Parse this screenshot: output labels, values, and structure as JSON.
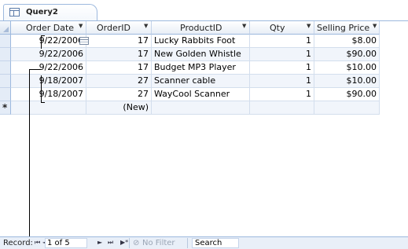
{
  "tab": {
    "label": "Query2",
    "icon": "query-table-icon"
  },
  "columns": [
    {
      "label": "Order Date",
      "has_arrow": true
    },
    {
      "label": "OrderID",
      "has_arrow": true
    },
    {
      "label": "ProductID",
      "has_arrow": true
    },
    {
      "label": "Qty",
      "has_arrow": true
    },
    {
      "label": "Selling Price",
      "has_arrow": true
    }
  ],
  "rows": [
    {
      "order_date": "9/22/2006",
      "order_id": "17",
      "product": "Lucky Rabbits Foot",
      "qty": "1",
      "price": "$8.00"
    },
    {
      "order_date": "9/22/2006",
      "order_id": "17",
      "product": "New Golden Whistle",
      "qty": "1",
      "price": "$90.00"
    },
    {
      "order_date": "9/22/2006",
      "order_id": "17",
      "product": "Budget MP3 Player",
      "qty": "1",
      "price": "$10.00"
    },
    {
      "order_date": "9/18/2007",
      "order_id": "27",
      "product": "Scanner cable",
      "qty": "1",
      "price": "$10.00"
    },
    {
      "order_date": "9/18/2007",
      "order_id": "27",
      "product": "WayCool Scanner",
      "qty": "1",
      "price": "$90.00"
    }
  ],
  "new_row": {
    "marker": "*",
    "order_id": "(New)"
  },
  "navigator": {
    "record_label": "Record:",
    "first": "⏮",
    "prev": "◄",
    "current": "1 of 5",
    "next": "►",
    "last": "⏭",
    "new": "▶*",
    "no_filter": "No Filter",
    "search": "Search"
  },
  "colors": {
    "header_border": "#9db9de",
    "alt_row": "#f1f5fb",
    "selector": "#e4ecf7"
  }
}
